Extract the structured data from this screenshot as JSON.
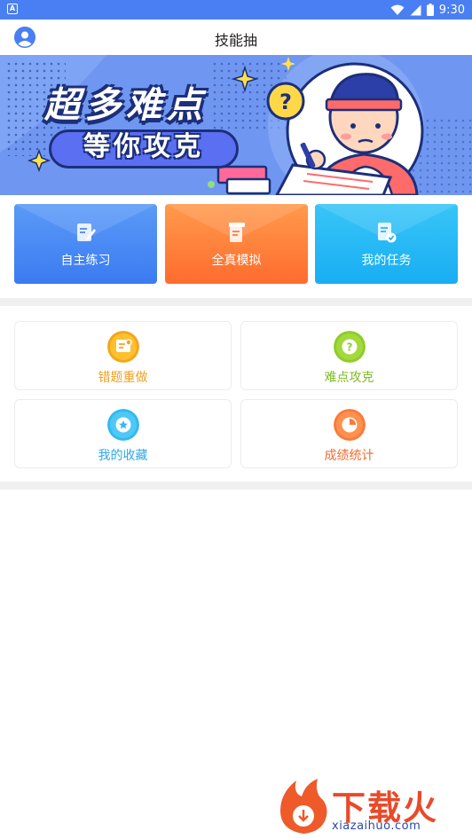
{
  "status_bar": {
    "time": "9:30",
    "notification_icon_letter": "A"
  },
  "app_bar": {
    "title": "技能抽",
    "avatar_icon": "user-avatar-icon"
  },
  "banner": {
    "headline": "超多难点",
    "subline": "等你攻克"
  },
  "top_actions": [
    {
      "label": "自主练习",
      "icon": "edit-document-icon",
      "color": "#3b7bf1"
    },
    {
      "label": "全真模拟",
      "icon": "exam-paper-icon",
      "color": "#ff6c2e"
    },
    {
      "label": "我的任务",
      "icon": "task-check-icon",
      "color": "#18aef3"
    }
  ],
  "grid_items": [
    {
      "label": "错题重做",
      "icon": "redo-card-icon",
      "color": "#f5a51c",
      "label_color": "#f0a020"
    },
    {
      "label": "难点攻克",
      "icon": "question-icon",
      "color": "#8fcc2a",
      "label_color": "#7dbb22"
    },
    {
      "label": "我的收藏",
      "icon": "star-icon",
      "color": "#32b9f0",
      "label_color": "#2ea8e6"
    },
    {
      "label": "成绩统计",
      "icon": "pie-chart-icon",
      "color": "#fb7a3a",
      "label_color": "#f26a2e"
    }
  ],
  "watermark": {
    "brand": "下载火",
    "url": "xiazaihuo.com"
  }
}
